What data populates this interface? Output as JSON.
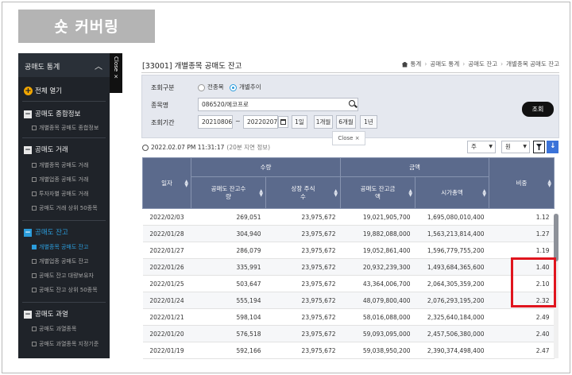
{
  "banner": {
    "text": "숏 커버링"
  },
  "sidebar": {
    "title": "공매도 통계",
    "collapse_icon": "chevron-up",
    "close_tab": "Close ×",
    "expand_all": "전체 열기",
    "categories": [
      {
        "label": "공매도 종합정보",
        "items": [
          "개별종목 공매도 종합정보"
        ]
      },
      {
        "label": "공매도 거래",
        "items": [
          "개별종목 공매도 거래",
          "개별업종 공매도 거래",
          "투자자별 공매도 거래",
          "공매도 거래 상위 50종목"
        ]
      },
      {
        "label": "공매도 잔고",
        "items": [
          "개별종목 공매도 잔고",
          "개별업종 공매도 잔고",
          "공매도 잔고 대량보유자",
          "공매도 잔고 상위 50종목"
        ]
      },
      {
        "label": "공매도 과열",
        "items": [
          "공매도 과열종목",
          "공매도 과열종목 지정기준"
        ]
      }
    ]
  },
  "main": {
    "title": "[33001] 개별종목 공매도 잔고",
    "breadcrumb": [
      "통계",
      "공매도 통계",
      "공매도 잔고",
      "개별종목 공매도 잔고"
    ],
    "search": {
      "type_label": "조회구분",
      "radio_all": "전종목",
      "radio_trend": "개별추이",
      "stock_label": "종목명",
      "stock_value": "086520/에코프로",
      "period_label": "조회기간",
      "date_from": "20210806",
      "date_to": "20220207",
      "tilde": "~",
      "periods": [
        "1일",
        "1개월",
        "6개월",
        "1년"
      ],
      "query_button": "조회",
      "close_tip": "Close ×"
    },
    "timestamp": "2022.02.07 PM 11:31:17",
    "timestamp_note": "(20분 지연 정보)",
    "select_period": "주",
    "select_unit": "원"
  },
  "table": {
    "h_date": "일자",
    "h_qty": "수량",
    "h_amt": "금액",
    "h_ratio": "비중",
    "h_short_qty": "공매도 잔고수량",
    "h_listed": "상장 주식수",
    "h_short_amt": "공매도 잔고금액",
    "h_mcap": "시가총액",
    "rows": [
      {
        "date": "2022/02/03",
        "short_qty": "269,051",
        "listed": "23,975,672",
        "short_amt": "19,021,905,700",
        "mcap": "1,695,080,010,400",
        "ratio": "1.12"
      },
      {
        "date": "2022/01/28",
        "short_qty": "304,940",
        "listed": "23,975,672",
        "short_amt": "19,882,088,000",
        "mcap": "1,563,213,814,400",
        "ratio": "1.27"
      },
      {
        "date": "2022/01/27",
        "short_qty": "286,079",
        "listed": "23,975,672",
        "short_amt": "19,052,861,400",
        "mcap": "1,596,779,755,200",
        "ratio": "1.19"
      },
      {
        "date": "2022/01/26",
        "short_qty": "335,991",
        "listed": "23,975,672",
        "short_amt": "20,932,239,300",
        "mcap": "1,493,684,365,600",
        "ratio": "1.40"
      },
      {
        "date": "2022/01/25",
        "short_qty": "503,647",
        "listed": "23,975,672",
        "short_amt": "43,364,006,700",
        "mcap": "2,064,305,359,200",
        "ratio": "2.10"
      },
      {
        "date": "2022/01/24",
        "short_qty": "555,194",
        "listed": "23,975,672",
        "short_amt": "48,079,800,400",
        "mcap": "2,076,293,195,200",
        "ratio": "2.32"
      },
      {
        "date": "2022/01/21",
        "short_qty": "598,104",
        "listed": "23,975,672",
        "short_amt": "58,016,088,000",
        "mcap": "2,325,640,184,000",
        "ratio": "2.49"
      },
      {
        "date": "2022/01/20",
        "short_qty": "576,518",
        "listed": "23,975,672",
        "short_amt": "59,093,095,000",
        "mcap": "2,457,506,380,000",
        "ratio": "2.40"
      },
      {
        "date": "2022/01/19",
        "short_qty": "592,166",
        "listed": "23,975,672",
        "short_amt": "59,038,950,200",
        "mcap": "2,390,374,498,400",
        "ratio": "2.47"
      }
    ]
  },
  "colors": {
    "sidebar_bg": "#1f2329",
    "header_bg": "#5b6a8c",
    "accent": "#2b9cdb",
    "highlight": "#e0151e"
  }
}
